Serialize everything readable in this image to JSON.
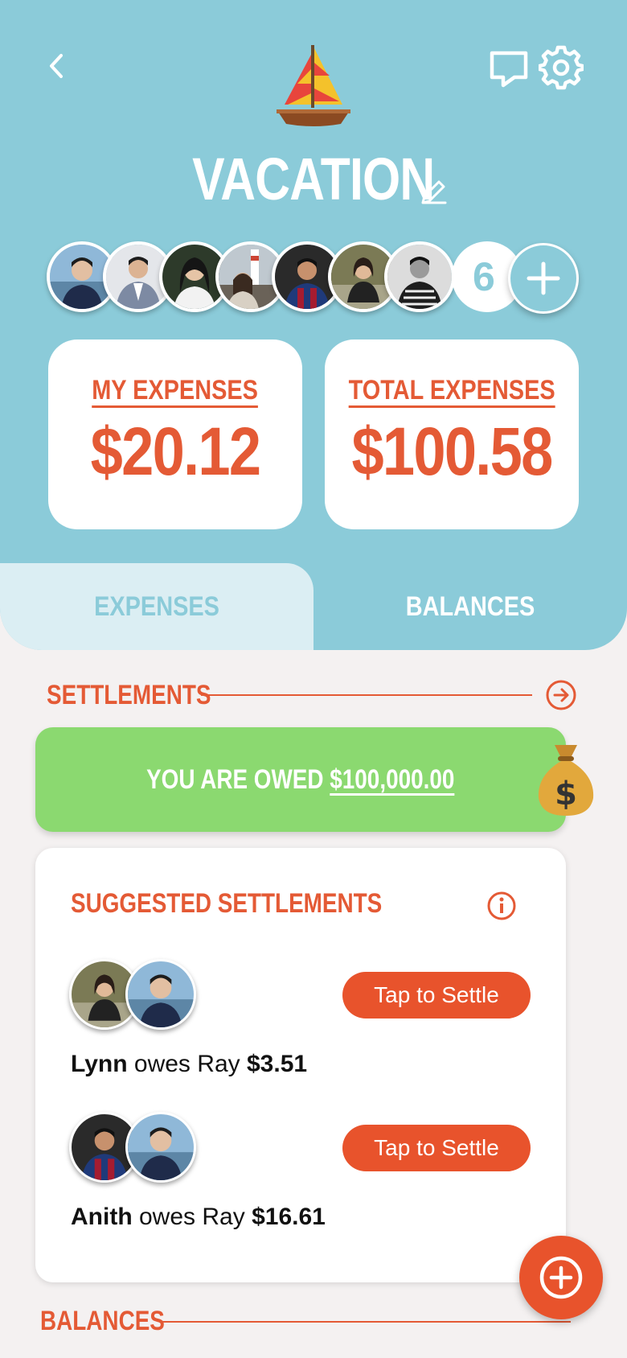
{
  "header": {
    "title": "VACATION",
    "member_overflow_count": "6",
    "icons": [
      "chevron-left-icon",
      "chat-bubble-icon",
      "gear-icon",
      "sailboat-emoji",
      "pencil-icon",
      "plus-icon"
    ]
  },
  "stats": {
    "my_expenses_label": "MY EXPENSES",
    "my_expenses_value": "$20.12",
    "total_expenses_label": "TOTAL EXPENSES",
    "total_expenses_value": "$100.58"
  },
  "tabs": [
    {
      "label": "EXPENSES",
      "selected": true
    },
    {
      "label": "BALANCES",
      "selected": false
    }
  ],
  "settlements": {
    "section_title": "SETTLEMENTS",
    "owed_prefix": "YOU ARE OWED",
    "owed_amount": "$100,000.00",
    "suggested_title": "SUGGESTED SETTLEMENTS",
    "items": [
      {
        "payer": "Lynn",
        "verb": "owes",
        "payee": "Ray",
        "amount": "$3.51",
        "button_label": "Tap to Settle"
      },
      {
        "payer": "Anith",
        "verb": "owes",
        "payee": "Ray",
        "amount": "$16.61",
        "button_label": "Tap to Settle"
      }
    ]
  },
  "balances": {
    "section_title": "BALANCES"
  },
  "colors": {
    "header_bg": "#8bcbd9",
    "accent": "#e45a35",
    "owed_banner": "#8bd970",
    "page_bg": "#f4f1f1"
  }
}
